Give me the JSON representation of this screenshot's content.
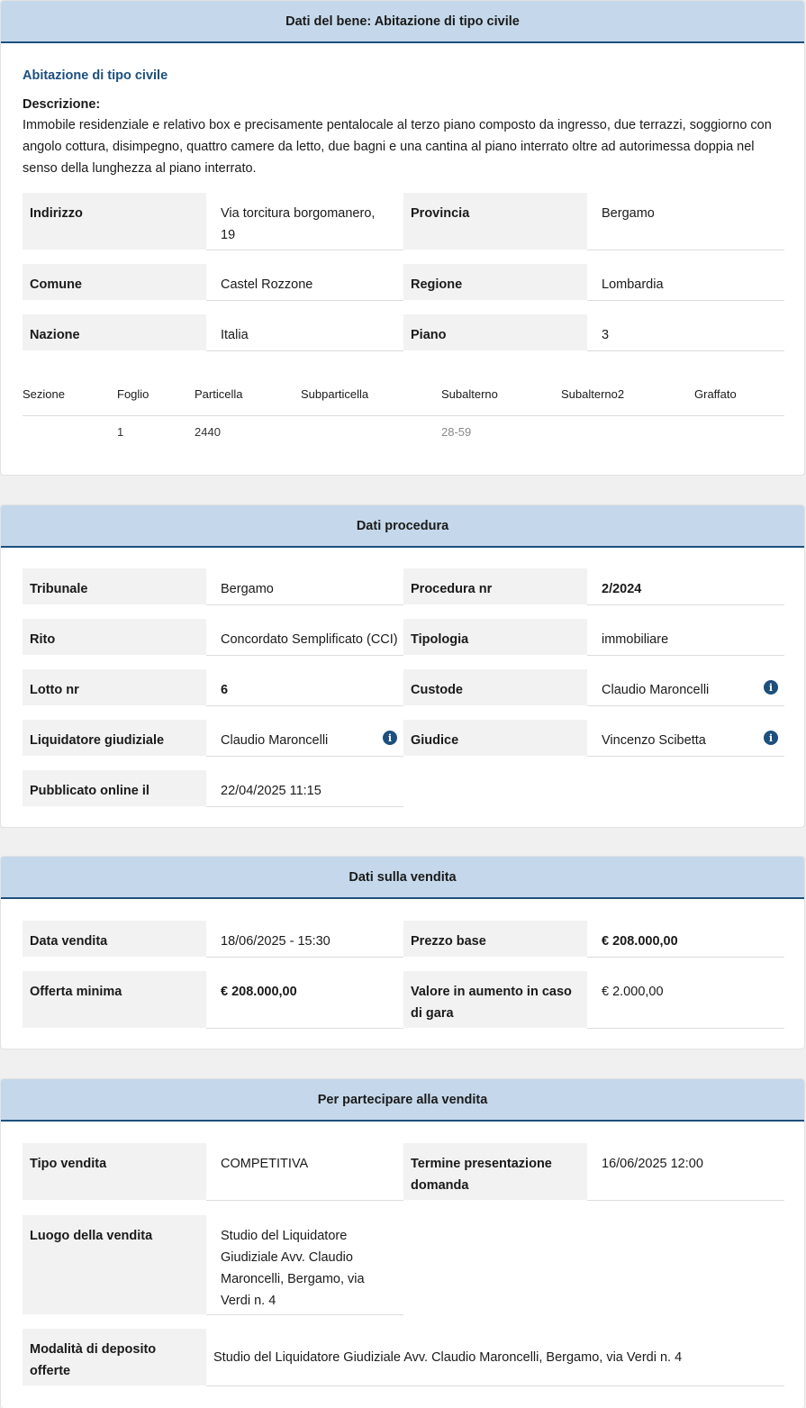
{
  "bene": {
    "header": "Dati del bene: Abitazione di tipo civile",
    "subtitle": "Abitazione di tipo civile",
    "descrizione_label": "Descrizione:",
    "descrizione": "Immobile residenziale e relativo box e precisamente pentalocale al terzo piano composto da ingresso, due terrazzi, soggiorno con angolo cottura, disimpegno, quattro camere da letto, due bagni e una cantina al piano interrato oltre ad autorimessa doppia nel senso della lunghezza al piano interrato.",
    "fields": {
      "indirizzo": {
        "label": "Indirizzo",
        "value": "Via torcitura borgomanero, 19"
      },
      "provincia": {
        "label": "Provincia",
        "value": "Bergamo"
      },
      "comune": {
        "label": "Comune",
        "value": "Castel Rozzone"
      },
      "regione": {
        "label": "Regione",
        "value": "Lombardia"
      },
      "nazione": {
        "label": "Nazione",
        "value": "Italia"
      },
      "piano": {
        "label": "Piano",
        "value": "3"
      }
    },
    "catasto": {
      "headers": [
        "Sezione",
        "Foglio",
        "Particella",
        "Subparticella",
        "Subalterno",
        "Subalterno2",
        "Graffato"
      ],
      "row": [
        "",
        "1",
        "2440",
        "",
        "28-59",
        "",
        ""
      ]
    }
  },
  "procedura": {
    "header": "Dati procedura",
    "fields": {
      "tribunale": {
        "label": "Tribunale",
        "value": "Bergamo"
      },
      "procedura_nr": {
        "label": "Procedura nr",
        "value": "2/2024"
      },
      "rito": {
        "label": "Rito",
        "value": "Concordato Semplificato (CCI)"
      },
      "tipologia": {
        "label": "Tipologia",
        "value": "immobiliare"
      },
      "lotto_nr": {
        "label": "Lotto nr",
        "value": "6"
      },
      "custode": {
        "label": "Custode",
        "value": "Claudio Maroncelli"
      },
      "liquidatore": {
        "label": "Liquidatore giudiziale",
        "value": "Claudio Maroncelli"
      },
      "giudice": {
        "label": "Giudice",
        "value": "Vincenzo Scibetta"
      },
      "pubblicato": {
        "label": "Pubblicato online il",
        "value": "22/04/2025 11:15"
      }
    },
    "info_icon": "info-circle-icon"
  },
  "vendita": {
    "header": "Dati sulla vendita",
    "fields": {
      "data_vendita": {
        "label": "Data vendita",
        "value": "18/06/2025 - 15:30"
      },
      "prezzo_base": {
        "label": "Prezzo base",
        "value": "€ 208.000,00"
      },
      "offerta_minima": {
        "label": "Offerta minima",
        "value": "€ 208.000,00"
      },
      "valore_aumento": {
        "label": "Valore in aumento in caso di gara",
        "value": "€ 2.000,00"
      }
    }
  },
  "partecipare": {
    "header": "Per partecipare alla vendita",
    "fields": {
      "tipo_vendita": {
        "label": "Tipo vendita",
        "value": "COMPETITIVA"
      },
      "termine": {
        "label": "Termine presentazione domanda",
        "value": "16/06/2025 12:00"
      },
      "luogo": {
        "label": "Luogo della vendita",
        "value": "Studio del Liquidatore Giudiziale Avv. Claudio Maroncelli, Bergamo, via Verdi n. 4"
      },
      "modalita": {
        "label": "Modalità di deposito offerte",
        "value": "Studio del Liquidatore Giudiziale Avv. Claudio Maroncelli, Bergamo, via Verdi n. 4"
      }
    }
  },
  "colors": {
    "header_bg": "#c5d8eb",
    "accent": "#1c4f7d",
    "label_bg": "#f2f2f2"
  }
}
